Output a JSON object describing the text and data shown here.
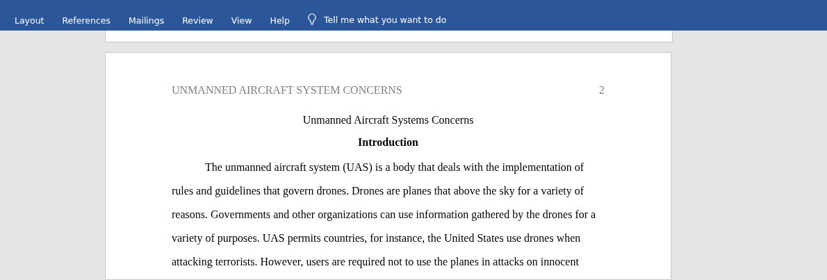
{
  "ribbon": {
    "tabs": [
      {
        "label": "Layout"
      },
      {
        "label": "References"
      },
      {
        "label": "Mailings"
      },
      {
        "label": "Review"
      },
      {
        "label": "View"
      },
      {
        "label": "Help"
      }
    ],
    "tell_me": {
      "placeholder": "Tell me what you want to do"
    }
  },
  "page": {
    "header": {
      "running_head": "UNMANNED AIRCRAFT SYSTEM CONCERNS",
      "page_number": "2"
    },
    "title": "Unmanned Aircraft Systems Concerns",
    "heading": "Introduction",
    "paragraph": "The unmanned aircraft system (UAS) is a body that deals with the implementation of rules and guidelines that govern drones. Drones are planes that above the sky for a variety of reasons. Governments and other organizations can use information gathered by the drones for a variety of purposes. UAS permits countries, for instance, the United States use drones when attacking terrorists. However, users are required not to use the planes in attacks on innocent"
  }
}
